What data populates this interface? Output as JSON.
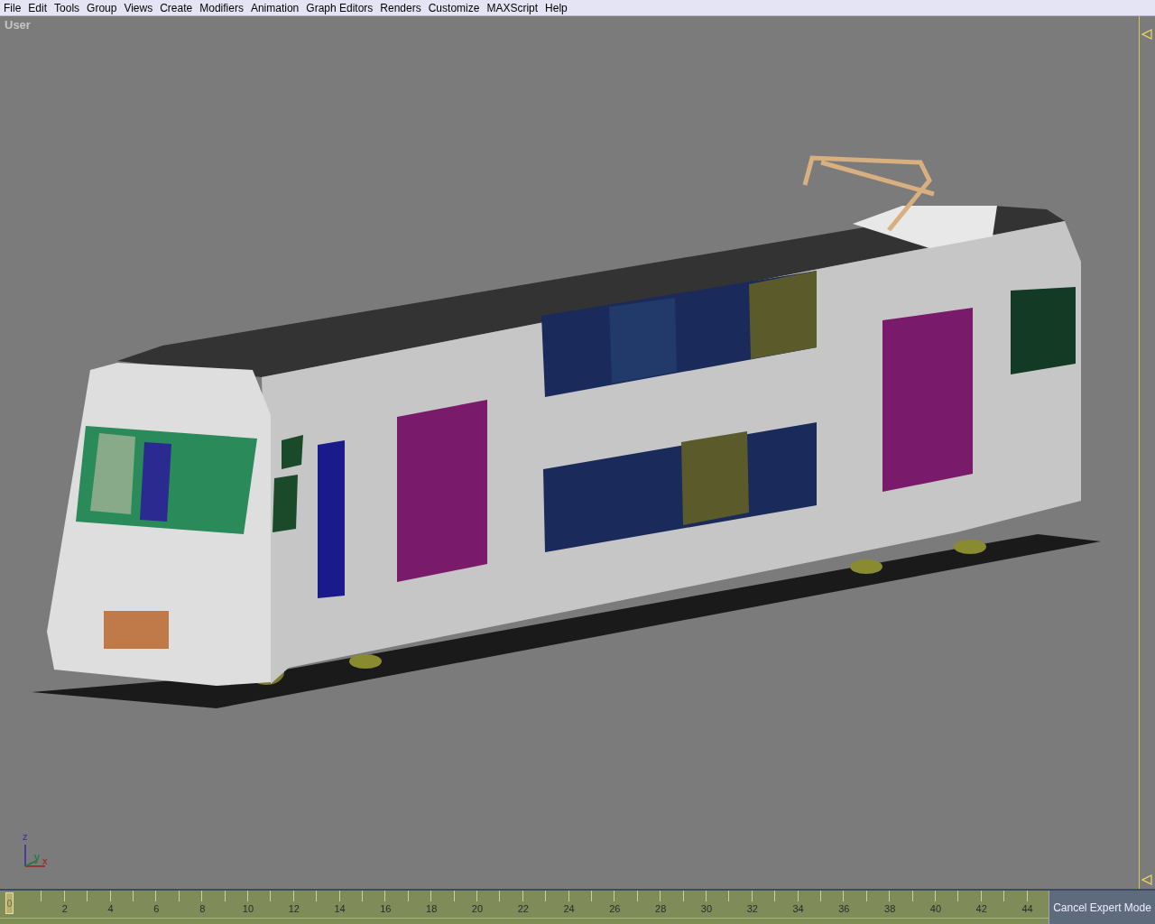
{
  "menu": [
    "File",
    "Edit",
    "Tools",
    "Group",
    "Views",
    "Create",
    "Modifiers",
    "Animation",
    "Graph Editors",
    "Renders",
    "Customize",
    "MAXScript",
    "Help"
  ],
  "viewport": {
    "label": "User",
    "axes": {
      "z": "z",
      "y": "y",
      "x": "x"
    }
  },
  "timeline": {
    "frame": "0",
    "ticks": [
      "2",
      "4",
      "6",
      "8",
      "10",
      "12",
      "14",
      "16",
      "18",
      "20",
      "22",
      "24",
      "26",
      "28",
      "30",
      "32",
      "34",
      "36",
      "38",
      "40",
      "42",
      "44"
    ]
  },
  "cancel_button": "Cancel Expert Mode"
}
